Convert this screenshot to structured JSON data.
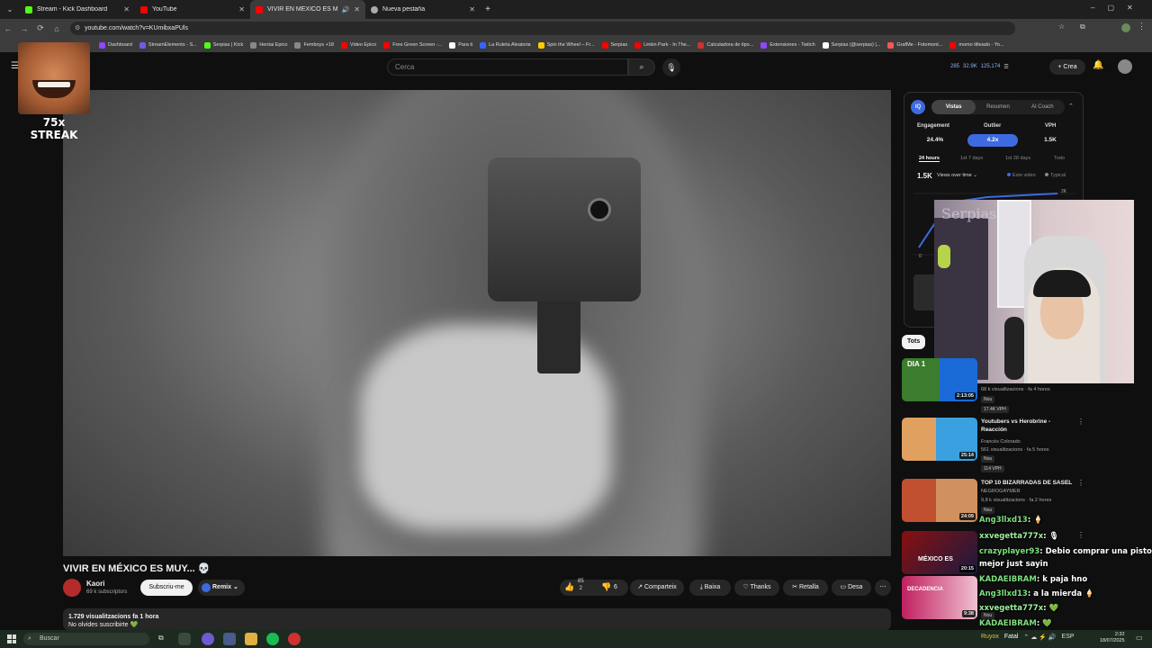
{
  "tabs": [
    {
      "title": "Stream - Kick Dashboard",
      "color": "#53fc18"
    },
    {
      "title": "YouTube",
      "color": "#ff0000"
    },
    {
      "title": "VIVIR EN MÉXICO ES MUY...",
      "color": "#ff0000"
    },
    {
      "title": "Nueva pestaña",
      "color": "#aaaaaa"
    }
  ],
  "address": {
    "url": "youtube.com/watch?v=KUmibxaPUls"
  },
  "bookmarks": [
    {
      "label": "Dashboard",
      "color": "#9146ff"
    },
    {
      "label": "StreamElements - S...",
      "color": "#6e5ce6"
    },
    {
      "label": "Serpias | Kick",
      "color": "#53fc18"
    },
    {
      "label": "Hentai Epico",
      "color": "#888888"
    },
    {
      "label": "Femboys +18",
      "color": "#888888"
    },
    {
      "label": "Video Epico",
      "color": "#ff0000"
    },
    {
      "label": "Free Green Screen -...",
      "color": "#ff0000"
    },
    {
      "label": "Para ti",
      "color": "#ffffff"
    },
    {
      "label": "La Ruleta Aleatoria",
      "color": "#3366ff"
    },
    {
      "label": "Spin the Wheel – Fr...",
      "color": "#ffcc00"
    },
    {
      "label": "Serpias",
      "color": "#ff0000"
    },
    {
      "label": "Linkin Park - In The...",
      "color": "#ff0000"
    },
    {
      "label": "Calculadora de tipo...",
      "color": "#cc3333"
    },
    {
      "label": "Extensiones - Twitch",
      "color": "#9146ff"
    },
    {
      "label": "Serpias (@serpias) |...",
      "color": "#ffffff"
    },
    {
      "label": "GrafMe - Fotomont...",
      "color": "#ff5555"
    },
    {
      "label": "momo tilteado - Yo...",
      "color": "#ff0000"
    }
  ],
  "header": {
    "search_placeholder": "Cerca",
    "stats": [
      "285",
      "32.9K",
      "125,174"
    ],
    "create_label": "Crea"
  },
  "overlay": {
    "streak_label": "75x STREAK"
  },
  "video": {
    "title": "VIVIR EN MÉXICO ES MUY... 💀",
    "channel": "Kaori",
    "subscribers": "69 k subscriptors",
    "subscribe_label": "Subscriu-me",
    "remix_label": "Remix",
    "likes": "85",
    "likes_sub": "2",
    "dislikes": "6",
    "share_label": "Comparteix",
    "download_label": "Baixa",
    "thanks_label": "Thanks",
    "clip_label": "Retalla",
    "save_label": "Desa",
    "views_line": "1.729 visualitzacions  fa 1 hora",
    "desc_line": "No olvides suscribirte 💚"
  },
  "analytics": {
    "logo": "IQ",
    "tabs": [
      "Vistas",
      "Resumen",
      "AI Coach"
    ],
    "metrics": [
      {
        "head": "Engagement",
        "value": "24.4%"
      },
      {
        "head": "Outlier",
        "value": "4.2x"
      },
      {
        "head": "VPH",
        "value": "1.5K"
      }
    ],
    "ranges": [
      "24 hours",
      "1st 7 days",
      "1st 28 days",
      "Todo"
    ],
    "total": "1.5K",
    "selector": "Views over time ⌄",
    "legend": [
      "Este video",
      "Typical"
    ],
    "y_tick_top": "2K",
    "y_tick_zero": "0",
    "accent": "#3e6ae1"
  },
  "webcam": {
    "wall_text": "Serpias"
  },
  "recommendations": {
    "chip": "Tots",
    "items": [
      {
        "title": "",
        "meta1": "68 k visualitzacions · fa 4 hores",
        "channel": "",
        "badge": "Nou",
        "vph": "17.4K VPH",
        "duration": "2:13:05",
        "thumb_text": "DIA 1",
        "colors": [
          "#3b7c2e",
          "#1a6ad8"
        ]
      },
      {
        "title": "Youtubers vs Herobrine - Reacción",
        "channel": "Francés Colorado",
        "meta1": "561 visualitzacions · fa 5 hores",
        "badge": "Nou",
        "vph": "114 VPH",
        "duration": "25:14",
        "colors": [
          "#e0a060",
          "#3aa0e0"
        ]
      },
      {
        "title": "TOP 10 BIZARRADAS DE SASEL",
        "channel": "NEGROGAYMER",
        "meta1": "9,8 k visualitzacions · fa 2 hores",
        "badge": "Nou",
        "vph": "",
        "duration": "24:09",
        "colors": [
          "#c05030",
          "#d09060"
        ]
      },
      {
        "title": "",
        "channel": "",
        "meta1": "",
        "badge": "",
        "vph": "",
        "duration": "20:15",
        "thumb_text": "MÉXICO ES",
        "colors": [
          "#8a1010",
          "#1a1a40"
        ]
      },
      {
        "title": "",
        "channel": "",
        "meta1": "",
        "badge": "Nou",
        "vph": "",
        "duration": "9:38",
        "thumb_text": "DECADENCIA",
        "colors": [
          "#c02060",
          "#f0c0d0"
        ]
      }
    ]
  },
  "chat": [
    {
      "user": "Ang3llxd13",
      "text": ": 🍦"
    },
    {
      "user": "xxvegetta777x",
      "text": ": 🎙"
    },
    {
      "user": "crazyplayer93",
      "text": ": Debio comprar una pistola"
    },
    {
      "user": "",
      "text": "mejor just sayin"
    },
    {
      "user": "KADAEIBRAM",
      "text": ": k paja hno"
    },
    {
      "user": "Ang3llxd13",
      "text": ": a la mierda 🍦"
    },
    {
      "user": "xxvegetta777x",
      "text": ": 💚"
    },
    {
      "user": "KADAEIBRAM",
      "text": ": 💚"
    }
  ],
  "taskbar": {
    "search_label": "Buscar",
    "tray_user": "Ruyox",
    "tray_text": "Fatal",
    "lang": "ESP",
    "time": "2:32",
    "date": "18/07/2025"
  }
}
